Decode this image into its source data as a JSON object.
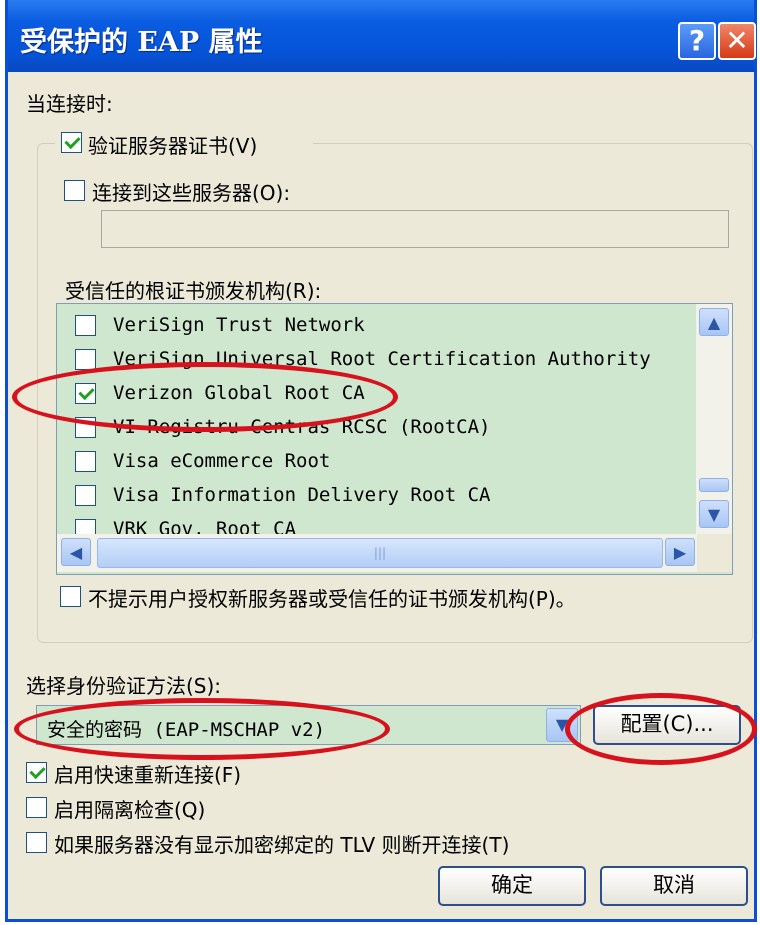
{
  "window": {
    "title": "受保护的 EAP 属性",
    "help_label": "?",
    "close_label": "✕"
  },
  "when_connecting": {
    "label": "当连接时:",
    "validate_cert": {
      "label": "验证服务器证书(V)",
      "checked": true
    },
    "connect_servers": {
      "label": "连接到这些服务器(O):",
      "checked": false,
      "value": ""
    },
    "trusted_root_label": "受信任的根证书颁发机构(R):",
    "cert_list": [
      {
        "label": "VeriSign Trust Network",
        "checked": false
      },
      {
        "label": "VeriSign Universal Root Certification Authority",
        "checked": false
      },
      {
        "label": "Verizon Global Root CA",
        "checked": true
      },
      {
        "label": "VI Registru Centras RCSC (RootCA)",
        "checked": false
      },
      {
        "label": "Visa eCommerce Root",
        "checked": false
      },
      {
        "label": "Visa Information Delivery Root CA",
        "checked": false
      },
      {
        "label": "VRK Gov. Root CA",
        "checked": false
      }
    ],
    "no_prompt": {
      "label": "不提示用户授权新服务器或受信任的证书颁发机构(P)。",
      "checked": false
    }
  },
  "auth_method": {
    "label": "选择身份验证方法(S):",
    "value": "安全的密码 (EAP-MSCHAP v2)",
    "configure_label": "配置(C)..."
  },
  "options": {
    "fast_reconnect": {
      "label": "启用快速重新连接(F)",
      "checked": true
    },
    "quarantine": {
      "label": "启用隔离检查(Q)",
      "checked": false
    },
    "tlv_disconnect": {
      "label": "如果服务器没有显示加密绑定的 TLV 则断开连接(T)",
      "checked": false
    }
  },
  "buttons": {
    "ok_label": "确定",
    "cancel_label": "取消"
  },
  "annotation_color": "#d8121c"
}
